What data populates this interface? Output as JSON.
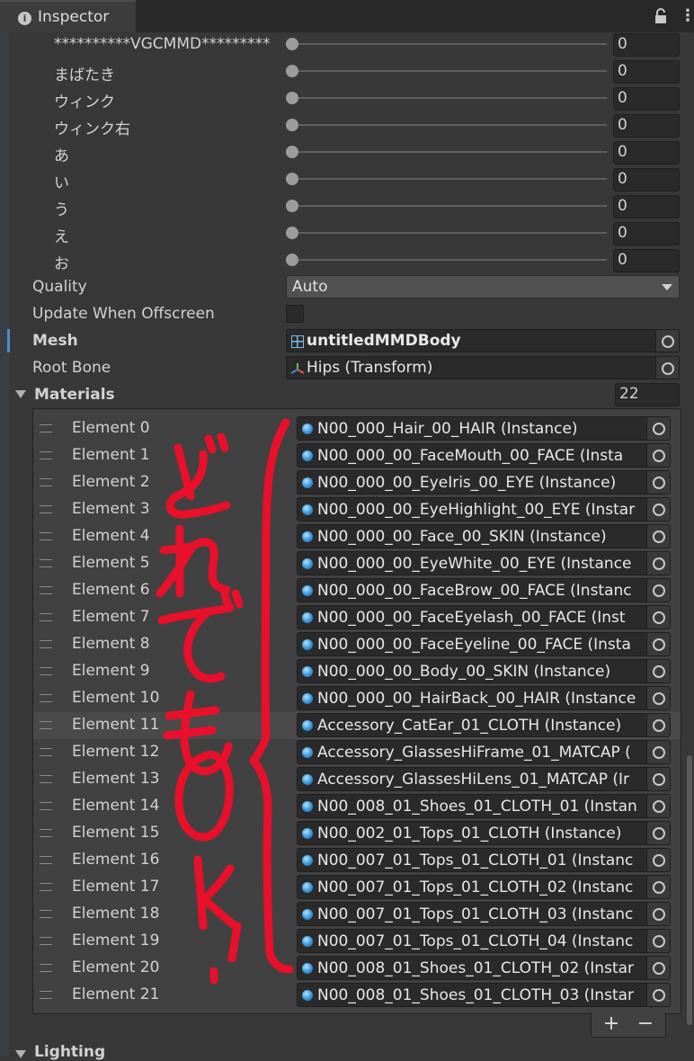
{
  "tab": {
    "title": "Inspector"
  },
  "blendshapes": [
    {
      "label": "**********VGCMMD*********",
      "value": "0"
    },
    {
      "label": "まばたき",
      "value": "0"
    },
    {
      "label": "ウィンク",
      "value": "0"
    },
    {
      "label": "ウィンク右",
      "value": "0"
    },
    {
      "label": "あ",
      "value": "0"
    },
    {
      "label": "い",
      "value": "0"
    },
    {
      "label": "う",
      "value": "0"
    },
    {
      "label": "え",
      "value": "0"
    },
    {
      "label": "お",
      "value": "0"
    }
  ],
  "quality": {
    "label": "Quality",
    "value": "Auto"
  },
  "update_offscreen": {
    "label": "Update When Offscreen",
    "checked": false
  },
  "mesh": {
    "label": "Mesh",
    "value": "untitledMMDBody"
  },
  "root_bone": {
    "label": "Root Bone",
    "value": "Hips (Transform)"
  },
  "materials": {
    "label": "Materials",
    "count": "22",
    "selected_index": 11,
    "elements": [
      {
        "label": "Element 0",
        "value": "N00_000_Hair_00_HAIR (Instance)"
      },
      {
        "label": "Element 1",
        "value": "N00_000_00_FaceMouth_00_FACE (Insta"
      },
      {
        "label": "Element 2",
        "value": "N00_000_00_EyeIris_00_EYE (Instance)"
      },
      {
        "label": "Element 3",
        "value": "N00_000_00_EyeHighlight_00_EYE (Instar"
      },
      {
        "label": "Element 4",
        "value": "N00_000_00_Face_00_SKIN (Instance)"
      },
      {
        "label": "Element 5",
        "value": "N00_000_00_EyeWhite_00_EYE (Instance"
      },
      {
        "label": "Element 6",
        "value": "N00_000_00_FaceBrow_00_FACE (Instanc"
      },
      {
        "label": "Element 7",
        "value": "N00_000_00_FaceEyelash_00_FACE (Inst"
      },
      {
        "label": "Element 8",
        "value": "N00_000_00_FaceEyeline_00_FACE (Insta"
      },
      {
        "label": "Element 9",
        "value": "N00_000_00_Body_00_SKIN (Instance)"
      },
      {
        "label": "Element 10",
        "value": "N00_000_00_HairBack_00_HAIR (Instance"
      },
      {
        "label": "Element 11",
        "value": "Accessory_CatEar_01_CLOTH (Instance)"
      },
      {
        "label": "Element 12",
        "value": "Accessory_GlassesHiFrame_01_MATCAP ("
      },
      {
        "label": "Element 13",
        "value": "Accessory_GlassesHiLens_01_MATCAP (Ir"
      },
      {
        "label": "Element 14",
        "value": "N00_008_01_Shoes_01_CLOTH_01 (Instan"
      },
      {
        "label": "Element 15",
        "value": "N00_002_01_Tops_01_CLOTH (Instance)"
      },
      {
        "label": "Element 16",
        "value": "N00_007_01_Tops_01_CLOTH_01 (Instanc"
      },
      {
        "label": "Element 17",
        "value": "N00_007_01_Tops_01_CLOTH_02 (Instanc"
      },
      {
        "label": "Element 18",
        "value": "N00_007_01_Tops_01_CLOTH_03 (Instanc"
      },
      {
        "label": "Element 19",
        "value": "N00_007_01_Tops_01_CLOTH_04 (Instanc"
      },
      {
        "label": "Element 20",
        "value": "N00_008_01_Shoes_01_CLOTH_02 (Instar"
      },
      {
        "label": "Element 21",
        "value": "N00_008_01_Shoes_01_CLOTH_03 (Instar"
      }
    ],
    "add_label": "+",
    "remove_label": "−"
  },
  "lighting": {
    "label": "Lighting"
  },
  "annotation": {
    "text": "どれでもOK!",
    "color": "#e8102a"
  },
  "icons": {
    "tab": "info-icon",
    "lock": "lock-icon",
    "menu": "kebab-menu-icon",
    "mesh": "mesh-grid-icon",
    "bone": "transform-icon",
    "material": "material-sphere-icon",
    "picker": "object-picker-icon"
  }
}
